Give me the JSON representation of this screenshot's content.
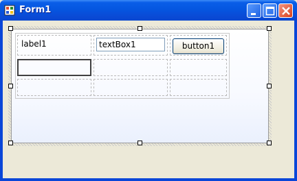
{
  "window": {
    "title": "Form1",
    "controls": {
      "minimize": "minimize-icon",
      "maximize": "maximize-icon",
      "close": "close-icon"
    }
  },
  "designer": {
    "label1": "label1",
    "textBox1": "textBox1",
    "button1": "button1"
  },
  "colors": {
    "titlebar": "#0556e0",
    "client": "#ece9d8",
    "close": "#d8411c"
  }
}
